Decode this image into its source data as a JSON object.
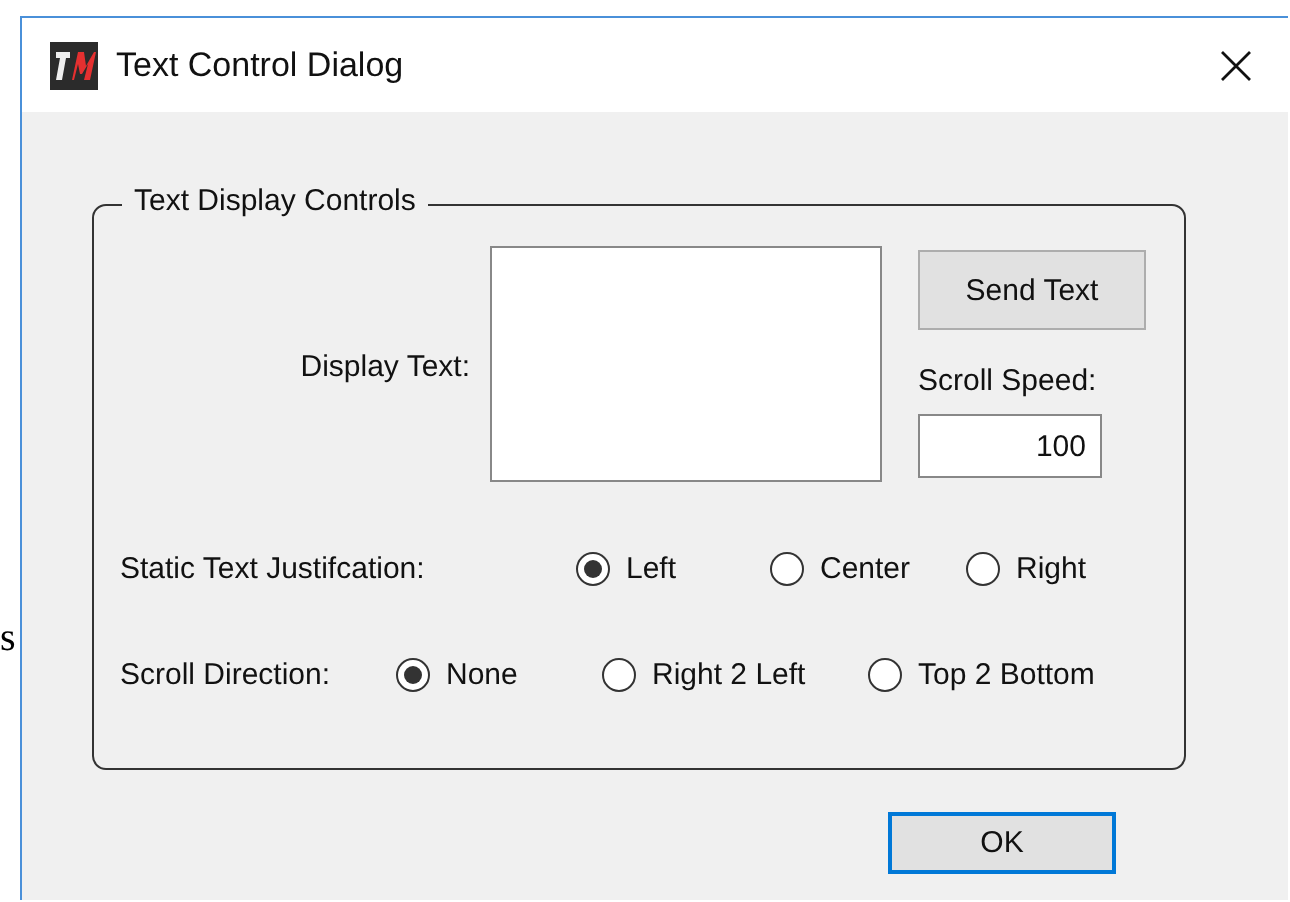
{
  "background_text": "s",
  "window": {
    "title": "Text Control Dialog"
  },
  "group": {
    "title": "Text Display Controls",
    "display_text": {
      "label": "Display Text:"
    },
    "send_button": "Send Text",
    "scroll_speed": {
      "label": "Scroll Speed:",
      "value": "100"
    },
    "radio_groups": [
      {
        "label": "Static Text Justifcation:",
        "options": [
          {
            "label": "Left",
            "selected": true
          },
          {
            "label": "Center",
            "selected": false
          },
          {
            "label": "Right",
            "selected": false
          }
        ]
      },
      {
        "label": "Scroll Direction:",
        "options": [
          {
            "label": "None",
            "selected": true
          },
          {
            "label": "Right 2 Left",
            "selected": false
          },
          {
            "label": "Top 2 Bottom",
            "selected": false
          }
        ]
      }
    ]
  },
  "buttons": [
    "OK"
  ]
}
